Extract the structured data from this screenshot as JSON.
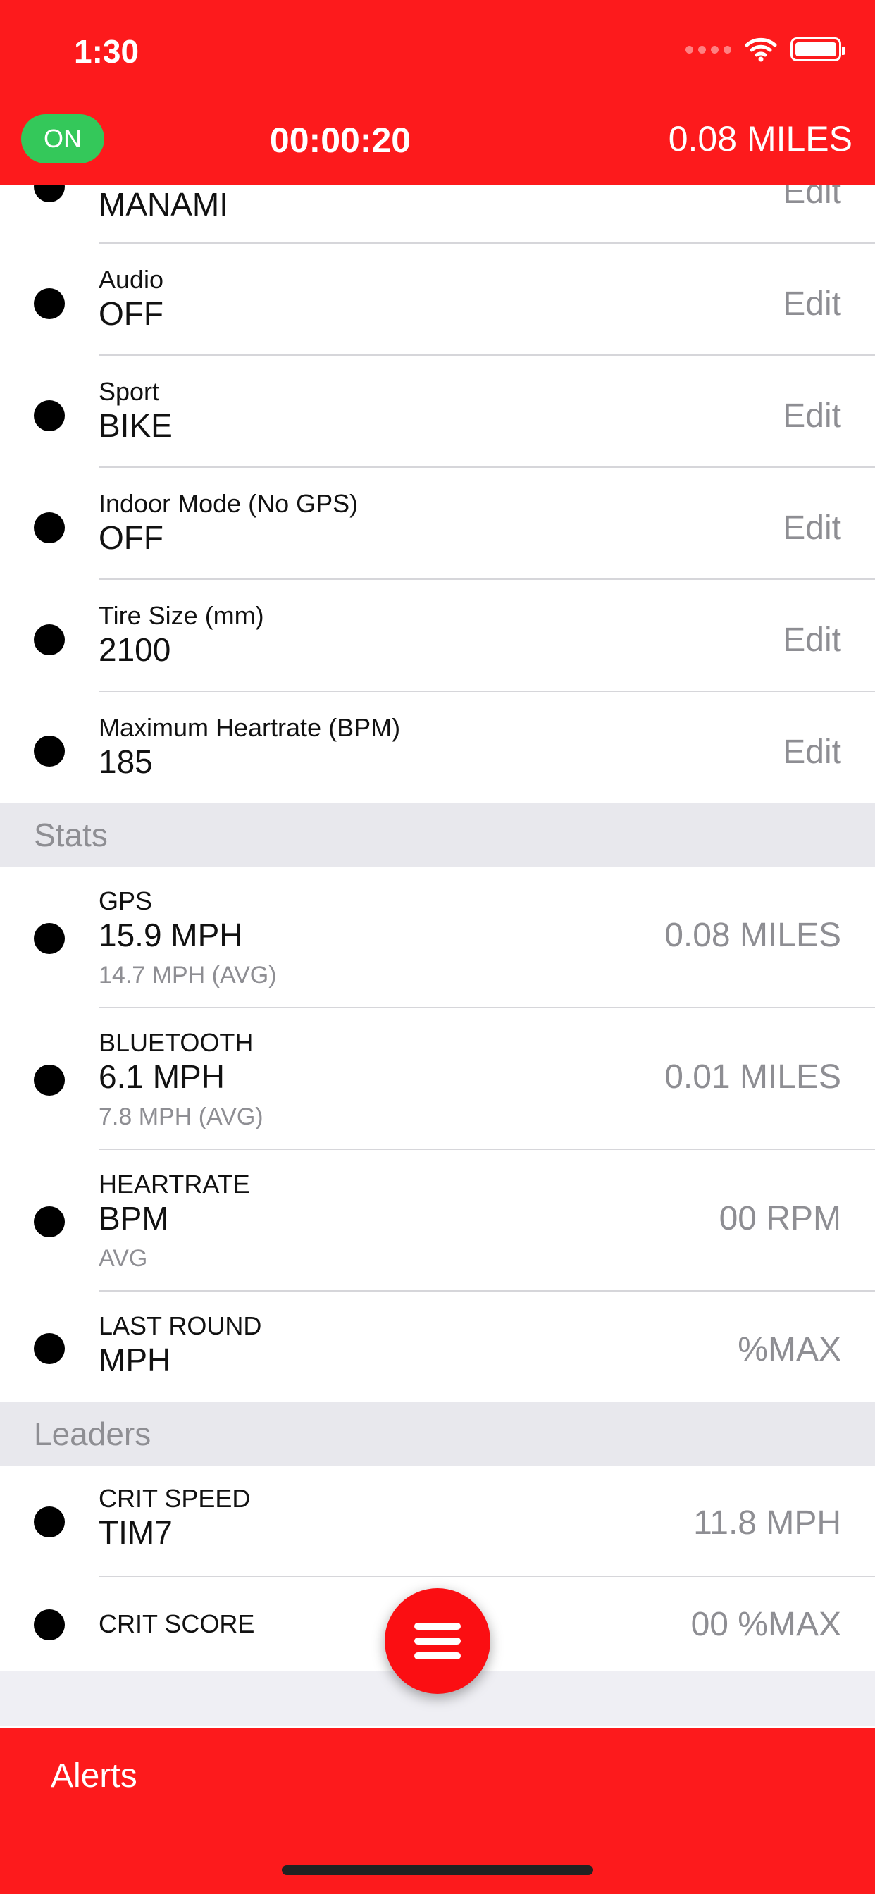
{
  "status_bar": {
    "time": "1:30"
  },
  "header": {
    "toggle_label": "ON",
    "timer": "00:00:20",
    "distance": "0.08 MILES"
  },
  "settings": {
    "edit_label": "Edit",
    "partial_value": "MANAMI",
    "partial_edit": "Edit",
    "rows": [
      {
        "label": "Audio",
        "value": "OFF"
      },
      {
        "label": "Sport",
        "value": "BIKE"
      },
      {
        "label": "Indoor Mode (No GPS)",
        "value": "OFF"
      },
      {
        "label": "Tire Size (mm)",
        "value": "2100"
      },
      {
        "label": "Maximum Heartrate (BPM)",
        "value": "185"
      }
    ]
  },
  "stats": {
    "title": "Stats",
    "rows": [
      {
        "label": "GPS",
        "value": "15.9 MPH",
        "sub": "14.7 MPH (AVG)",
        "right": "0.08 MILES"
      },
      {
        "label": "BLUETOOTH",
        "value": "6.1 MPH",
        "sub": "7.8 MPH (AVG)",
        "right": "0.01 MILES"
      },
      {
        "label": "HEARTRATE",
        "value": "BPM",
        "sub": "AVG",
        "right": "00 RPM"
      },
      {
        "label": "LAST ROUND",
        "value": "MPH",
        "right": "%MAX"
      }
    ]
  },
  "leaders": {
    "title": "Leaders",
    "rows": [
      {
        "label": "CRIT SPEED",
        "value": "TIM7",
        "right": "11.8 MPH"
      },
      {
        "label": "CRIT SCORE",
        "right": "00 %MAX"
      }
    ]
  },
  "bottom_bar": {
    "alerts_label": "Alerts"
  },
  "colors": {
    "brand_red": "#fd1a1c",
    "toggle_green": "#34c85a",
    "gray_text": "#8e8e93"
  }
}
